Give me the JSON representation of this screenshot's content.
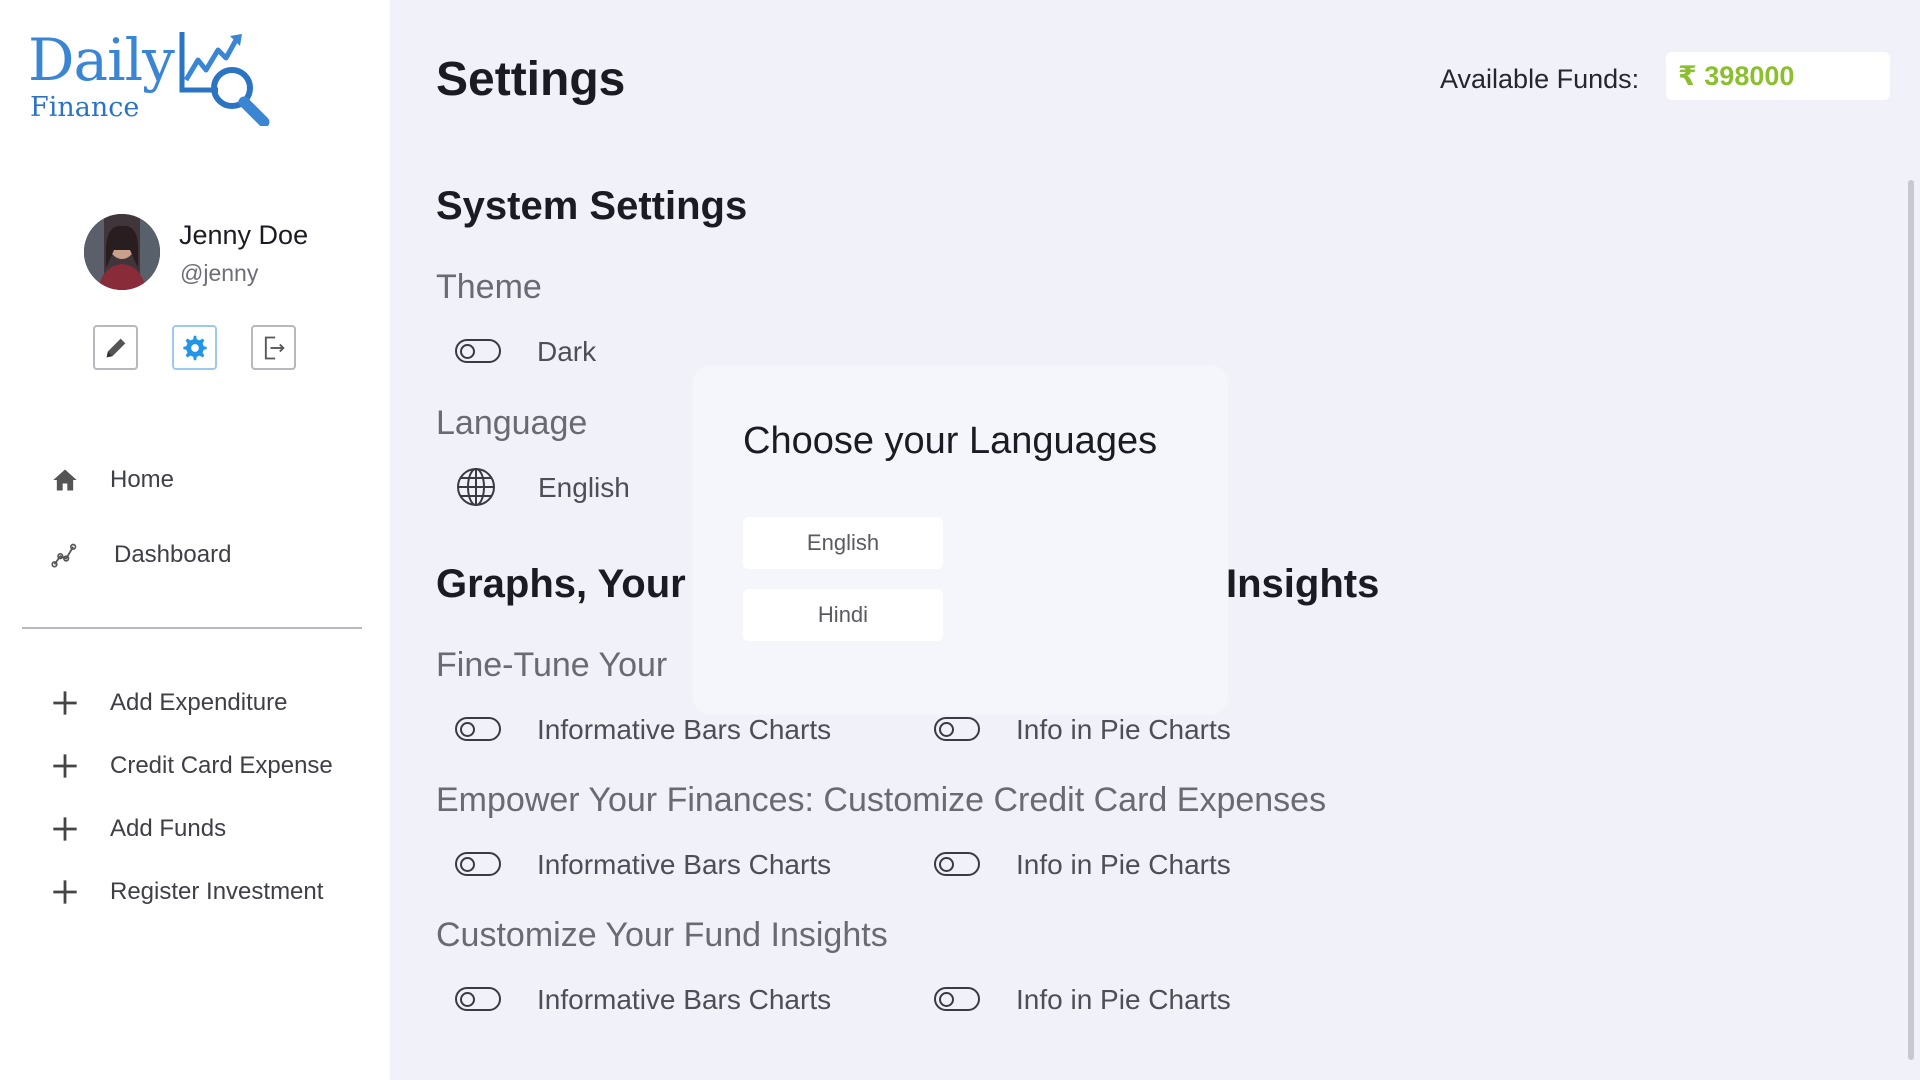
{
  "brand": {
    "name": "Daily",
    "sub": "Finance"
  },
  "user": {
    "name": "Jenny Doe",
    "handle": "@jenny"
  },
  "profile_actions": [
    {
      "icon": "pencil-icon"
    },
    {
      "icon": "gear-icon",
      "active": true
    },
    {
      "icon": "logout-icon"
    }
  ],
  "nav": {
    "primary": [
      {
        "label": "Home",
        "icon": "home-icon"
      },
      {
        "label": "Dashboard",
        "icon": "chart-icon"
      }
    ],
    "secondary": [
      {
        "label": "Add Expenditure",
        "icon": "plus-icon"
      },
      {
        "label": "Credit Card Expense",
        "icon": "plus-icon"
      },
      {
        "label": "Add Funds",
        "icon": "plus-icon"
      },
      {
        "label": "Register Investment",
        "icon": "plus-icon"
      }
    ]
  },
  "header": {
    "title": "Settings",
    "funds_label": "Available Funds:",
    "funds_value": "₹ 398000",
    "funds_color": "#8cbf2f"
  },
  "system": {
    "title": "System Settings",
    "theme": {
      "title": "Theme",
      "toggle_label": "Dark",
      "on": false
    },
    "language": {
      "title": "Language",
      "value": "English"
    }
  },
  "graphs": {
    "title_left": "Graphs, Your",
    "title_right": "Insights",
    "groups": [
      {
        "title": "Fine-Tune Your",
        "bars_label": "Informative Bars Charts",
        "pie_label": "Info in Pie Charts"
      },
      {
        "title": "Empower Your Finances: Customize Credit Card Expenses",
        "bars_label": "Informative Bars Charts",
        "pie_label": "Info in Pie Charts"
      },
      {
        "title": "Customize Your Fund Insights",
        "bars_label": "Informative Bars Charts",
        "pie_label": "Info in Pie Charts"
      }
    ]
  },
  "language_modal": {
    "title": "Choose your Languages",
    "options": [
      "English",
      "Hindi"
    ]
  }
}
